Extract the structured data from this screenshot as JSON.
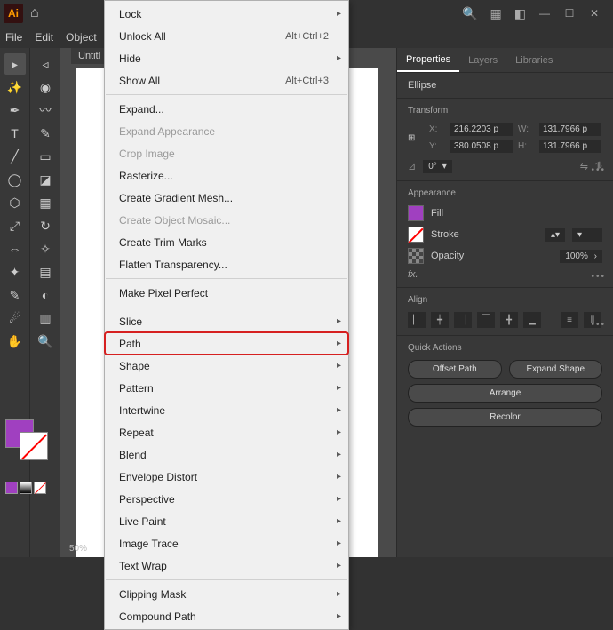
{
  "menubar": {
    "file": "File",
    "edit": "Edit",
    "object": "Object"
  },
  "tabTitle": "Untitl",
  "zoom": "50%",
  "rightTabs": {
    "properties": "Properties",
    "layers": "Layers",
    "libraries": "Libraries"
  },
  "shape": "Ellipse",
  "transform": {
    "label": "Transform",
    "xL": "X:",
    "x": "216.2203 p",
    "yL": "Y:",
    "y": "380.0508 p",
    "wL": "W:",
    "w": "131.7966 p",
    "hL": "H:",
    "h": "131.7966 p",
    "angleL": "⊿",
    "angle": "0°"
  },
  "appearance": {
    "label": "Appearance",
    "fill": "Fill",
    "stroke": "Stroke",
    "opacity": "Opacity",
    "opVal": "100%",
    "fx": "fx."
  },
  "align": {
    "label": "Align"
  },
  "quick": {
    "label": "Quick Actions",
    "offset": "Offset Path",
    "expand": "Expand Shape",
    "arrange": "Arrange",
    "recolor": "Recolor"
  },
  "menu": {
    "lock": "Lock",
    "unlockAll": "Unlock All",
    "unlockSc": "Alt+Ctrl+2",
    "hide": "Hide",
    "showAll": "Show All",
    "showAllSc": "Alt+Ctrl+3",
    "expand": "Expand...",
    "expandApp": "Expand Appearance",
    "crop": "Crop Image",
    "raster": "Rasterize...",
    "gradMesh": "Create Gradient Mesh...",
    "objMosaic": "Create Object Mosaic...",
    "trim": "Create Trim Marks",
    "flatten": "Flatten Transparency...",
    "pixelPerfect": "Make Pixel Perfect",
    "slice": "Slice",
    "path": "Path",
    "shape": "Shape",
    "pattern": "Pattern",
    "intertwine": "Intertwine",
    "repeat": "Repeat",
    "blend": "Blend",
    "envelope": "Envelope Distort",
    "perspective": "Perspective",
    "livePaint": "Live Paint",
    "imgTrace": "Image Trace",
    "textWrap": "Text Wrap",
    "clip": "Clipping Mask",
    "compound": "Compound Path"
  }
}
